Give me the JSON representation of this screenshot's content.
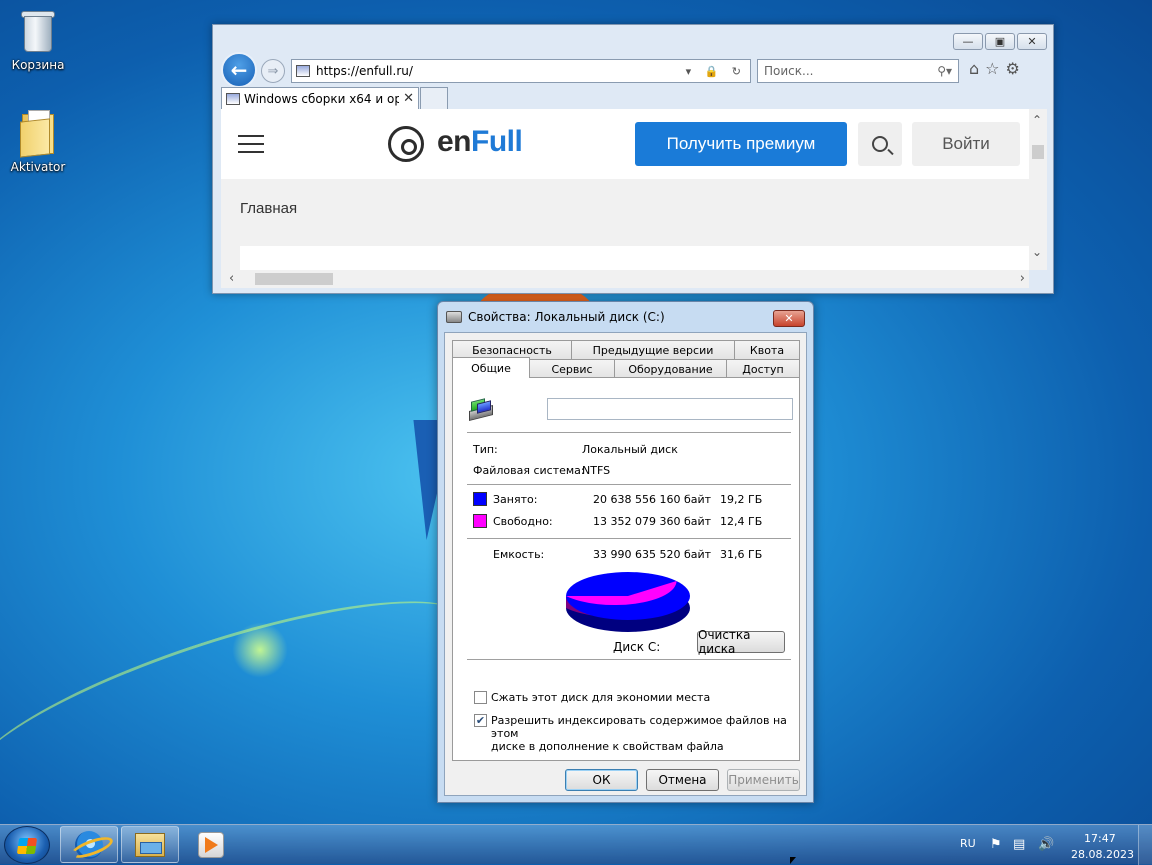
{
  "desktop": {
    "icons": [
      {
        "label": "Корзина",
        "icon": "recycle-bin-icon"
      },
      {
        "label": "Aktivator",
        "icon": "folder-icon"
      }
    ]
  },
  "browser": {
    "url": "https://enfull.ru/",
    "search_placeholder": "Поиск...",
    "tab_title": "Windows сборки x64 и ор...",
    "site": {
      "logo_prefix": "en",
      "logo_highlight": "Full",
      "premium_button": "Получить премиум",
      "login_button": "Войти",
      "breadcrumb": "Главная"
    }
  },
  "dialog": {
    "title": "Свойства: Локальный диск (C:)",
    "tabs_row1": [
      "Безопасность",
      "Предыдущие версии",
      "Квота"
    ],
    "tabs_row2": [
      "Общие",
      "Сервис",
      "Оборудование",
      "Доступ"
    ],
    "active_tab": "Общие",
    "label_value": "",
    "type_label": "Тип:",
    "type_value": "Локальный диск",
    "fs_label": "Файловая система:",
    "fs_value": "NTFS",
    "used_label": "Занято:",
    "used_bytes": "20 638 556 160 байт",
    "used_gb": "19,2 ГБ",
    "free_label": "Свободно:",
    "free_bytes": "13 352 079 360 байт",
    "free_gb": "12,4 ГБ",
    "capacity_label": "Емкость:",
    "capacity_bytes": "33 990 635 520 байт",
    "capacity_gb": "31,6 ГБ",
    "used_fraction": 0.607,
    "used_color": "#0000ff",
    "free_color": "#ff00ff",
    "disk_caption": "Диск C:",
    "cleanup_button": "Очистка диска",
    "compress_label": "Сжать этот диск для экономии места",
    "compress_checked": false,
    "index_label_line1": "Разрешить индексировать содержимое файлов на этом",
    "index_label_line2": "диске в дополнение к свойствам файла",
    "index_checked": true,
    "ok_button": "ОК",
    "cancel_button": "Отмена",
    "apply_button": "Применить"
  },
  "taskbar": {
    "language": "RU",
    "time": "17:47",
    "date": "28.08.2023",
    "pinned": [
      "internet-explorer-icon",
      "windows-explorer-icon",
      "media-player-icon"
    ]
  }
}
